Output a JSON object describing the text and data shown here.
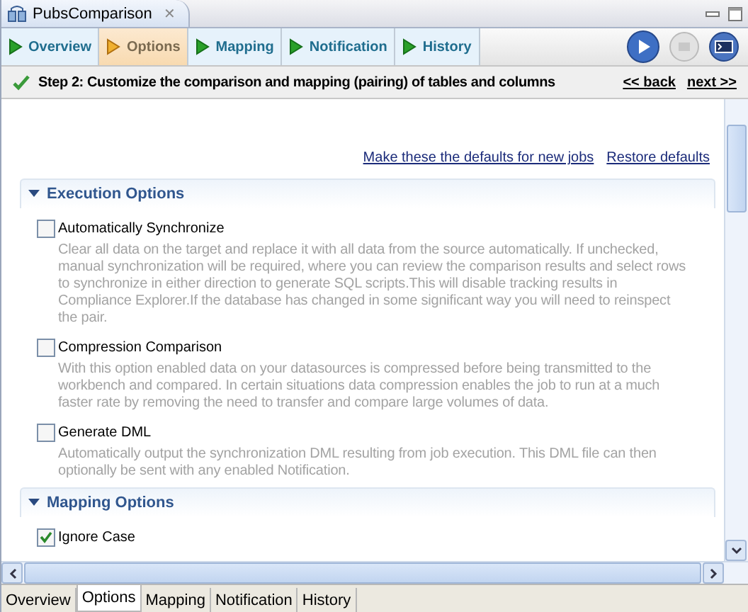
{
  "editor_tab": {
    "title": "PubsComparison",
    "close": "✕"
  },
  "wizard_tabs": [
    {
      "label": "Overview",
      "selected": false
    },
    {
      "label": "Options",
      "selected": true
    },
    {
      "label": "Mapping",
      "selected": false
    },
    {
      "label": "Notification",
      "selected": false
    },
    {
      "label": "History",
      "selected": false
    }
  ],
  "step": {
    "title": "Step 2: Customize the comparison and mapping (pairing) of tables and columns",
    "back": "<< back",
    "next": "next >>"
  },
  "links": [
    "Make these the defaults for new jobs",
    "Restore defaults"
  ],
  "sections": [
    {
      "title": "Execution Options",
      "expanded": true,
      "options": [
        {
          "label": "Automatically Synchronize",
          "checked": false,
          "description": "Clear all data on the target and replace it with all data from the source automatically. If unchecked, manual synchronization will be required, where you can review the comparison results and select rows to synchronize in either direction to generate SQL scripts.This will disable tracking results in Compliance Explorer.If the database has changed in some significant way you will need to reinspect the pair."
        },
        {
          "label": "Compression Comparison",
          "checked": false,
          "description": "With this option enabled data on your datasources is compressed before being transmitted to the workbench and compared. In certain situations data compression enables the job to run at a much faster rate by removing the need to transfer and compare large volumes of data."
        },
        {
          "label": "Generate DML",
          "checked": false,
          "description": "Automatically output the synchronization DML resulting from job execution. This DML file can then optionally be sent with any enabled Notification."
        }
      ]
    },
    {
      "title": "Mapping Options",
      "expanded": true,
      "options": [
        {
          "label": "Ignore Case",
          "checked": true
        }
      ]
    }
  ],
  "bottom_tabs": [
    {
      "label": "Overview",
      "selected": false
    },
    {
      "label": "Options",
      "selected": true
    },
    {
      "label": "Mapping",
      "selected": false
    },
    {
      "label": "Notification",
      "selected": false
    },
    {
      "label": "History",
      "selected": false
    }
  ]
}
